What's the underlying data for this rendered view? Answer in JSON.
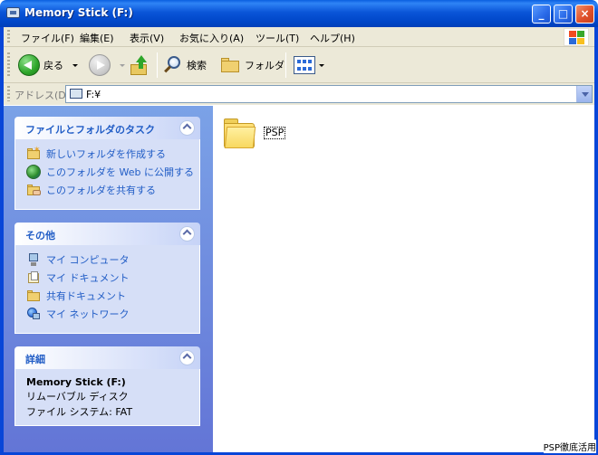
{
  "window": {
    "title": "Memory Stick (F:)",
    "minimize_label": "_",
    "maximize_label": "□",
    "close_label": "×"
  },
  "menubar": {
    "items": [
      {
        "label": "ファイル(F)"
      },
      {
        "label": "編集(E)"
      },
      {
        "label": "表示(V)"
      },
      {
        "label": "お気に入り(A)"
      },
      {
        "label": "ツール(T)"
      },
      {
        "label": "ヘルプ(H)"
      }
    ]
  },
  "toolbar": {
    "back_label": "戻る",
    "search_label": "検索",
    "folders_label": "フォルダ"
  },
  "address": {
    "label": "アドレス(D)",
    "value": "F:¥"
  },
  "taskpane": {
    "file_tasks": {
      "title": "ファイルとフォルダのタスク",
      "items": [
        {
          "label": "新しいフォルダを作成する",
          "icon": "new-folder-icon"
        },
        {
          "label": "このフォルダを Web に公開する",
          "icon": "web-publish-icon"
        },
        {
          "label": "このフォルダを共有する",
          "icon": "share-folder-icon"
        }
      ]
    },
    "other_places": {
      "title": "その他",
      "items": [
        {
          "label": "マイ コンピュータ",
          "icon": "my-computer-icon"
        },
        {
          "label": "マイ ドキュメント",
          "icon": "my-documents-icon"
        },
        {
          "label": "共有ドキュメント",
          "icon": "shared-documents-icon"
        },
        {
          "label": "マイ ネットワーク",
          "icon": "my-network-icon"
        }
      ]
    },
    "details": {
      "title": "詳細",
      "name": "Memory Stick (F:)",
      "type": "リムーバブル ディスク",
      "filesystem": "ファイル システム: FAT"
    }
  },
  "content": {
    "items": [
      {
        "name": "PSP",
        "icon": "folder-icon"
      }
    ]
  },
  "credit": "PSP徹底活用",
  "colors": {
    "titlebar": "#0a55d8",
    "taskpane_top": "#7ba2e7",
    "taskpane_bottom": "#6375d6",
    "panel_body": "#d6dff7",
    "link_text": "#215dc6"
  }
}
